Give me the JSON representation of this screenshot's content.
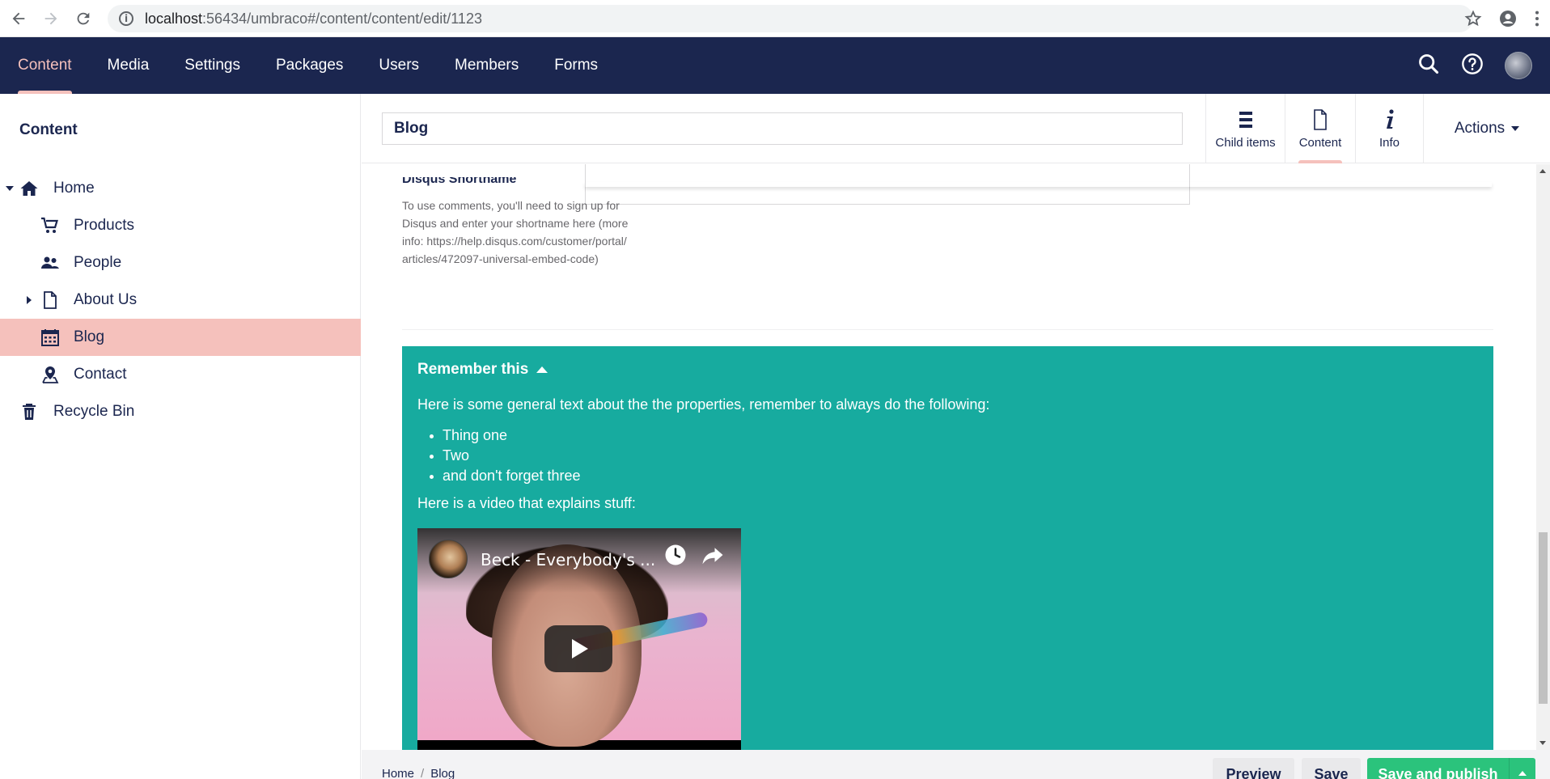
{
  "browser": {
    "url_host": "localhost",
    "url_path": ":56434/umbraco#/content/content/edit/1123"
  },
  "header": {
    "sections": [
      {
        "label": "Content"
      },
      {
        "label": "Media"
      },
      {
        "label": "Settings"
      },
      {
        "label": "Packages"
      },
      {
        "label": "Users"
      },
      {
        "label": "Members"
      },
      {
        "label": "Forms"
      }
    ],
    "active_section": "Content",
    "bg_color": "#1b264f",
    "active_color": "#f5c1bc"
  },
  "sidebar": {
    "title": "Content",
    "items": [
      {
        "label": "Home",
        "icon": "home-icon"
      },
      {
        "label": "Products",
        "icon": "shopping-cart-icon"
      },
      {
        "label": "People",
        "icon": "users-icon"
      },
      {
        "label": "About Us",
        "icon": "document-icon"
      },
      {
        "label": "Blog",
        "icon": "calendar-icon"
      },
      {
        "label": "Contact",
        "icon": "map-pin-icon"
      },
      {
        "label": "Recycle Bin",
        "icon": "trash-icon"
      }
    ],
    "selected": "Blog"
  },
  "editor": {
    "name_value": "Blog",
    "apps": [
      {
        "label": "Child items",
        "icon": "list-icon"
      },
      {
        "label": "Content",
        "icon": "document-icon"
      },
      {
        "label": "Info",
        "icon": "info-icon"
      }
    ],
    "active_app": "Content",
    "actions_label": "Actions"
  },
  "property": {
    "label": "Disqus Shortname",
    "description": "To use comments, you'll need to sign up for Disqus and enter your shortname here (more info: https://help.disqus.com/customer/portal/articles/472097-universal-embed-code)"
  },
  "note": {
    "title": "Remember this",
    "intro": "Here is some general text about the the properties, remember to always do the following:",
    "items": [
      "Thing one",
      "Two",
      "and don't forget three"
    ],
    "video_intro": "Here is a video that explains stuff:",
    "video_title": "Beck - Everybody's ...",
    "bg_color": "#17ab9f"
  },
  "footer": {
    "breadcrumb": [
      "Home",
      "Blog"
    ],
    "preview_label": "Preview",
    "save_label": "Save",
    "publish_label": "Save and publish",
    "publish_color": "#2bc37c"
  }
}
